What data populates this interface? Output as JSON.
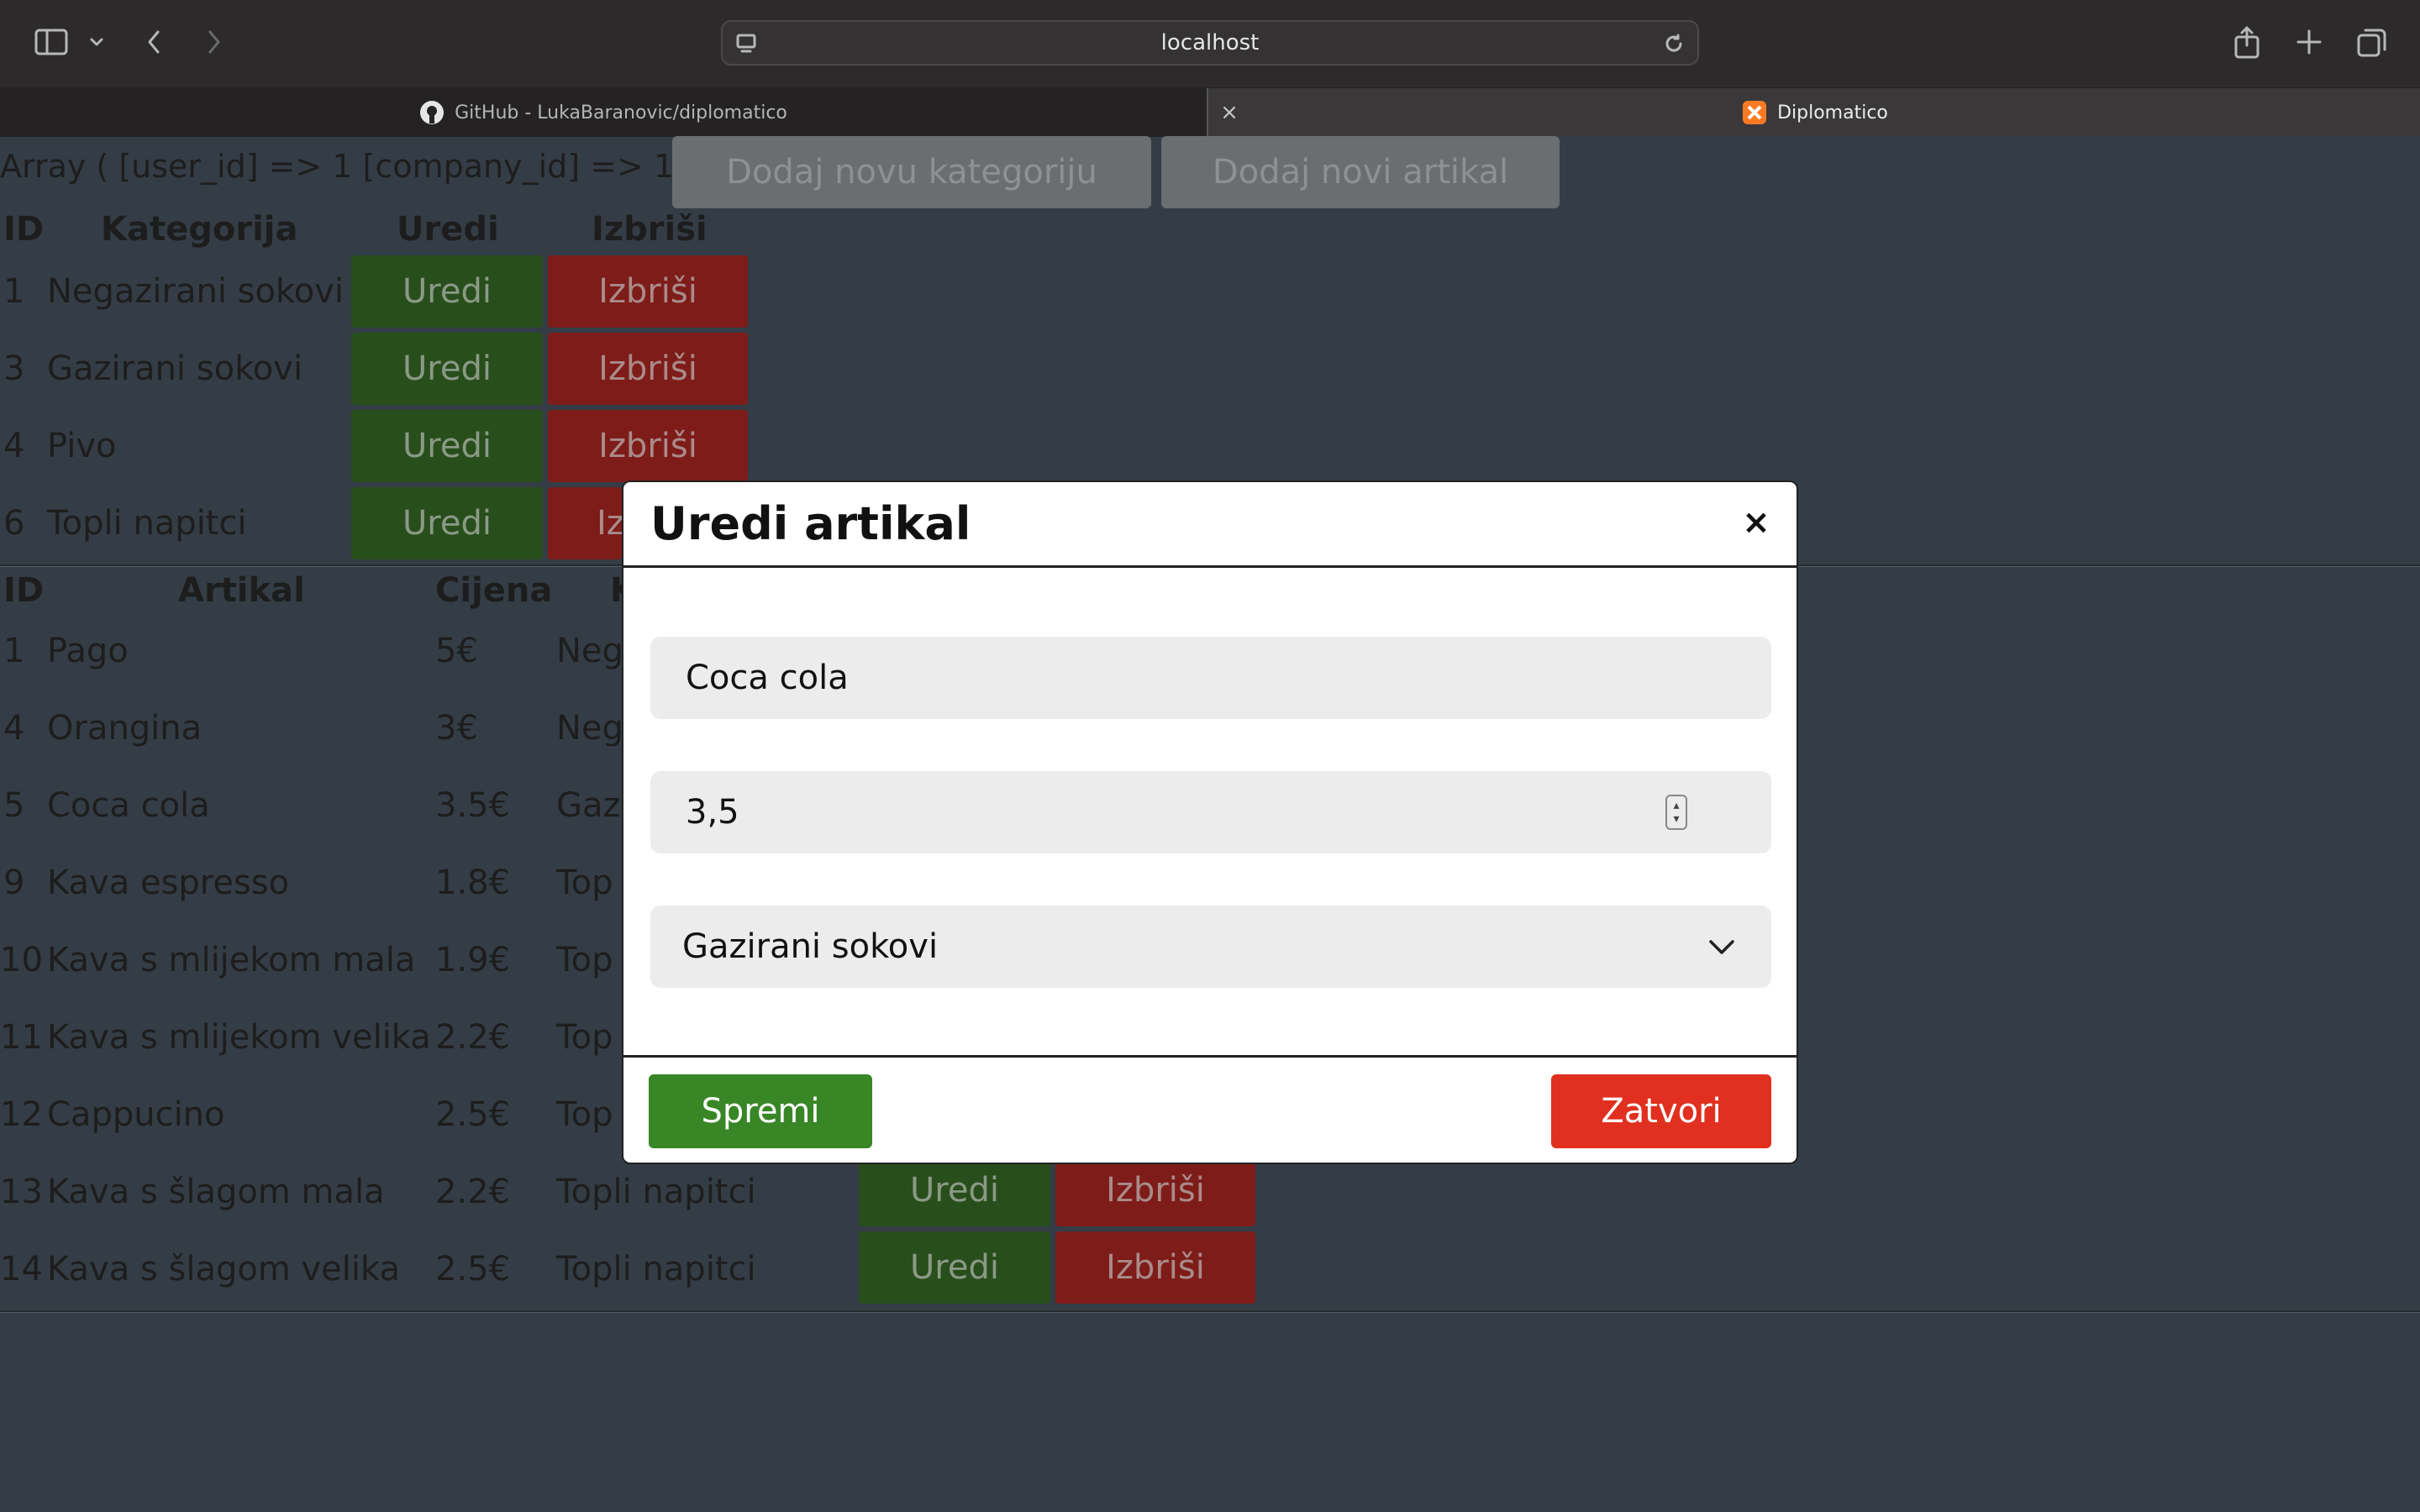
{
  "browser": {
    "url": "localhost",
    "tabs": [
      {
        "label": "GitHub - LukaBaranovic/diplomatico",
        "icon": "github-icon"
      },
      {
        "label": "Diplomatico",
        "icon": "xampp-icon"
      }
    ]
  },
  "page": {
    "array_text": "Array ( [user_id] => 1 [company_id] => 1 )",
    "add_category_label": "Dodaj novu kategoriju",
    "add_article_label": "Dodaj novi artikal",
    "categories": {
      "headers": [
        "ID",
        "Kategorija",
        "Uredi",
        "Izbriši"
      ],
      "rows": [
        {
          "id": "1",
          "name": "Negazirani sokovi"
        },
        {
          "id": "3",
          "name": "Gazirani sokovi"
        },
        {
          "id": "4",
          "name": "Pivo"
        },
        {
          "id": "6",
          "name": "Topli napitci"
        }
      ]
    },
    "articles": {
      "headers": [
        "ID",
        "Artikal",
        "Cijena",
        "K"
      ],
      "rows": [
        {
          "id": "1",
          "name": "Pago",
          "price": "5€",
          "category": "Neg"
        },
        {
          "id": "4",
          "name": "Orangina",
          "price": "3€",
          "category": "Neg"
        },
        {
          "id": "5",
          "name": "Coca cola",
          "price": "3.5€",
          "category": "Gaz"
        },
        {
          "id": "9",
          "name": "Kava espresso",
          "price": "1.8€",
          "category": "Top"
        },
        {
          "id": "10",
          "name": "Kava s mlijekom mala",
          "price": "1.9€",
          "category": "Top"
        },
        {
          "id": "11",
          "name": "Kava s mlijekom velika",
          "price": "2.2€",
          "category": "Top"
        },
        {
          "id": "12",
          "name": "Cappucino",
          "price": "2.5€",
          "category": "Top"
        },
        {
          "id": "13",
          "name": "Kava s šlagom mala",
          "price": "2.2€",
          "category": "Topli napitci"
        },
        {
          "id": "14",
          "name": "Kava s šlagom velika",
          "price": "2.5€",
          "category": "Topli napitci"
        }
      ]
    },
    "edit_label": "Uredi",
    "delete_label": "Izbriši",
    "delete_partial": "Iz"
  },
  "modal": {
    "title": "Uredi artikal",
    "close_symbol": "×",
    "name_value": "Coca cola",
    "price_value": "3,5",
    "category_value": "Gazirani sokovi",
    "save_label": "Spremi",
    "close_label": "Zatvori"
  },
  "colors": {
    "page_bg": "#343d46",
    "edit_button": "#284e1b",
    "delete_button": "#7e1c19",
    "save_button": "#388626",
    "close_button": "#e1301f"
  }
}
